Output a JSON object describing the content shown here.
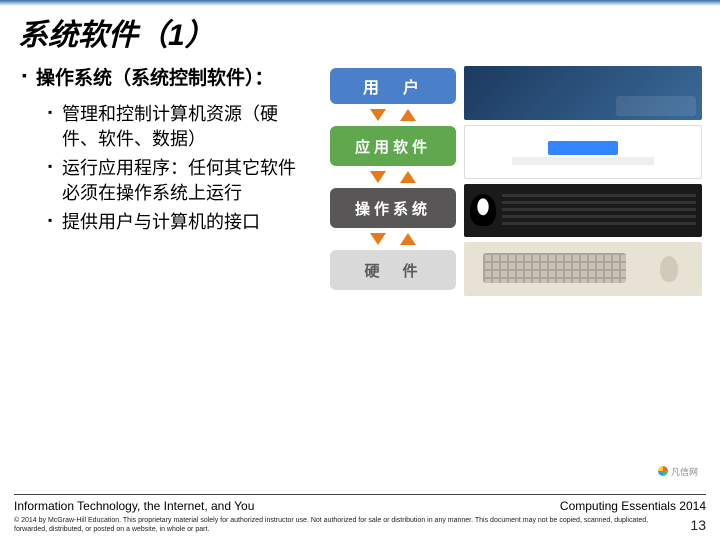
{
  "title": "系统软件（1）",
  "heading": "操作系统（系统控制软件）：",
  "bullets": [
    "管理和控制计算机资源（硬件、软件、数据）",
    "运行应用程序：任何其它软件必须在操作系统上运行",
    "提供用户与计算机的接口"
  ],
  "layers": {
    "user": "用　户",
    "app": "应用软件",
    "os": "操作系统",
    "hw": "硬　件"
  },
  "watermark": "凡信网",
  "footer": {
    "left": "Information Technology, the Internet, and You",
    "right": "Computing Essentials 2014",
    "copyright": "© 2014 by McGraw-Hill Education. This proprietary material solely for authorized instructor use. Not authorized for sale or distribution in any manner. This document may not be copied, scanned, duplicated, forwarded, distributed, or posted on a website, in whole or part.",
    "page": "13"
  }
}
